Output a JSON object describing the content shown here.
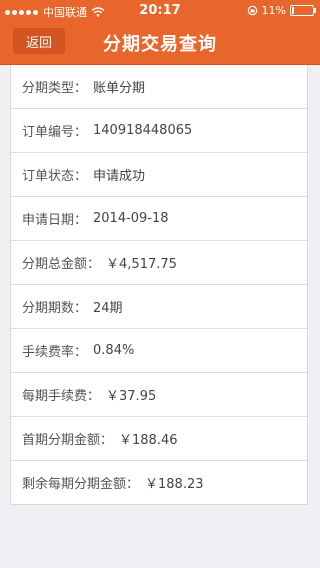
{
  "status_bar": {
    "carrier": "中国联通",
    "time": "20:17",
    "battery_text": "11%",
    "battery_level": 0.11
  },
  "nav": {
    "back_label": "返回",
    "title": "分期交易查询"
  },
  "details": [
    {
      "label": "分期类型：",
      "value": "账单分期"
    },
    {
      "label": "订单编号：",
      "value": "140918448065"
    },
    {
      "label": "订单状态：",
      "value": "申请成功"
    },
    {
      "label": "申请日期：",
      "value": "2014-09-18"
    },
    {
      "label": "分期总金额：",
      "value": "￥4,517.75"
    },
    {
      "label": "分期期数：",
      "value": "24期"
    },
    {
      "label": "手续费率：",
      "value": "0.84%"
    },
    {
      "label": "每期手续费：",
      "value": "￥37.95"
    },
    {
      "label": "首期分期金额：",
      "value": "￥188.46"
    },
    {
      "label": "剩余每期分期金额：",
      "value": "￥188.23"
    }
  ]
}
